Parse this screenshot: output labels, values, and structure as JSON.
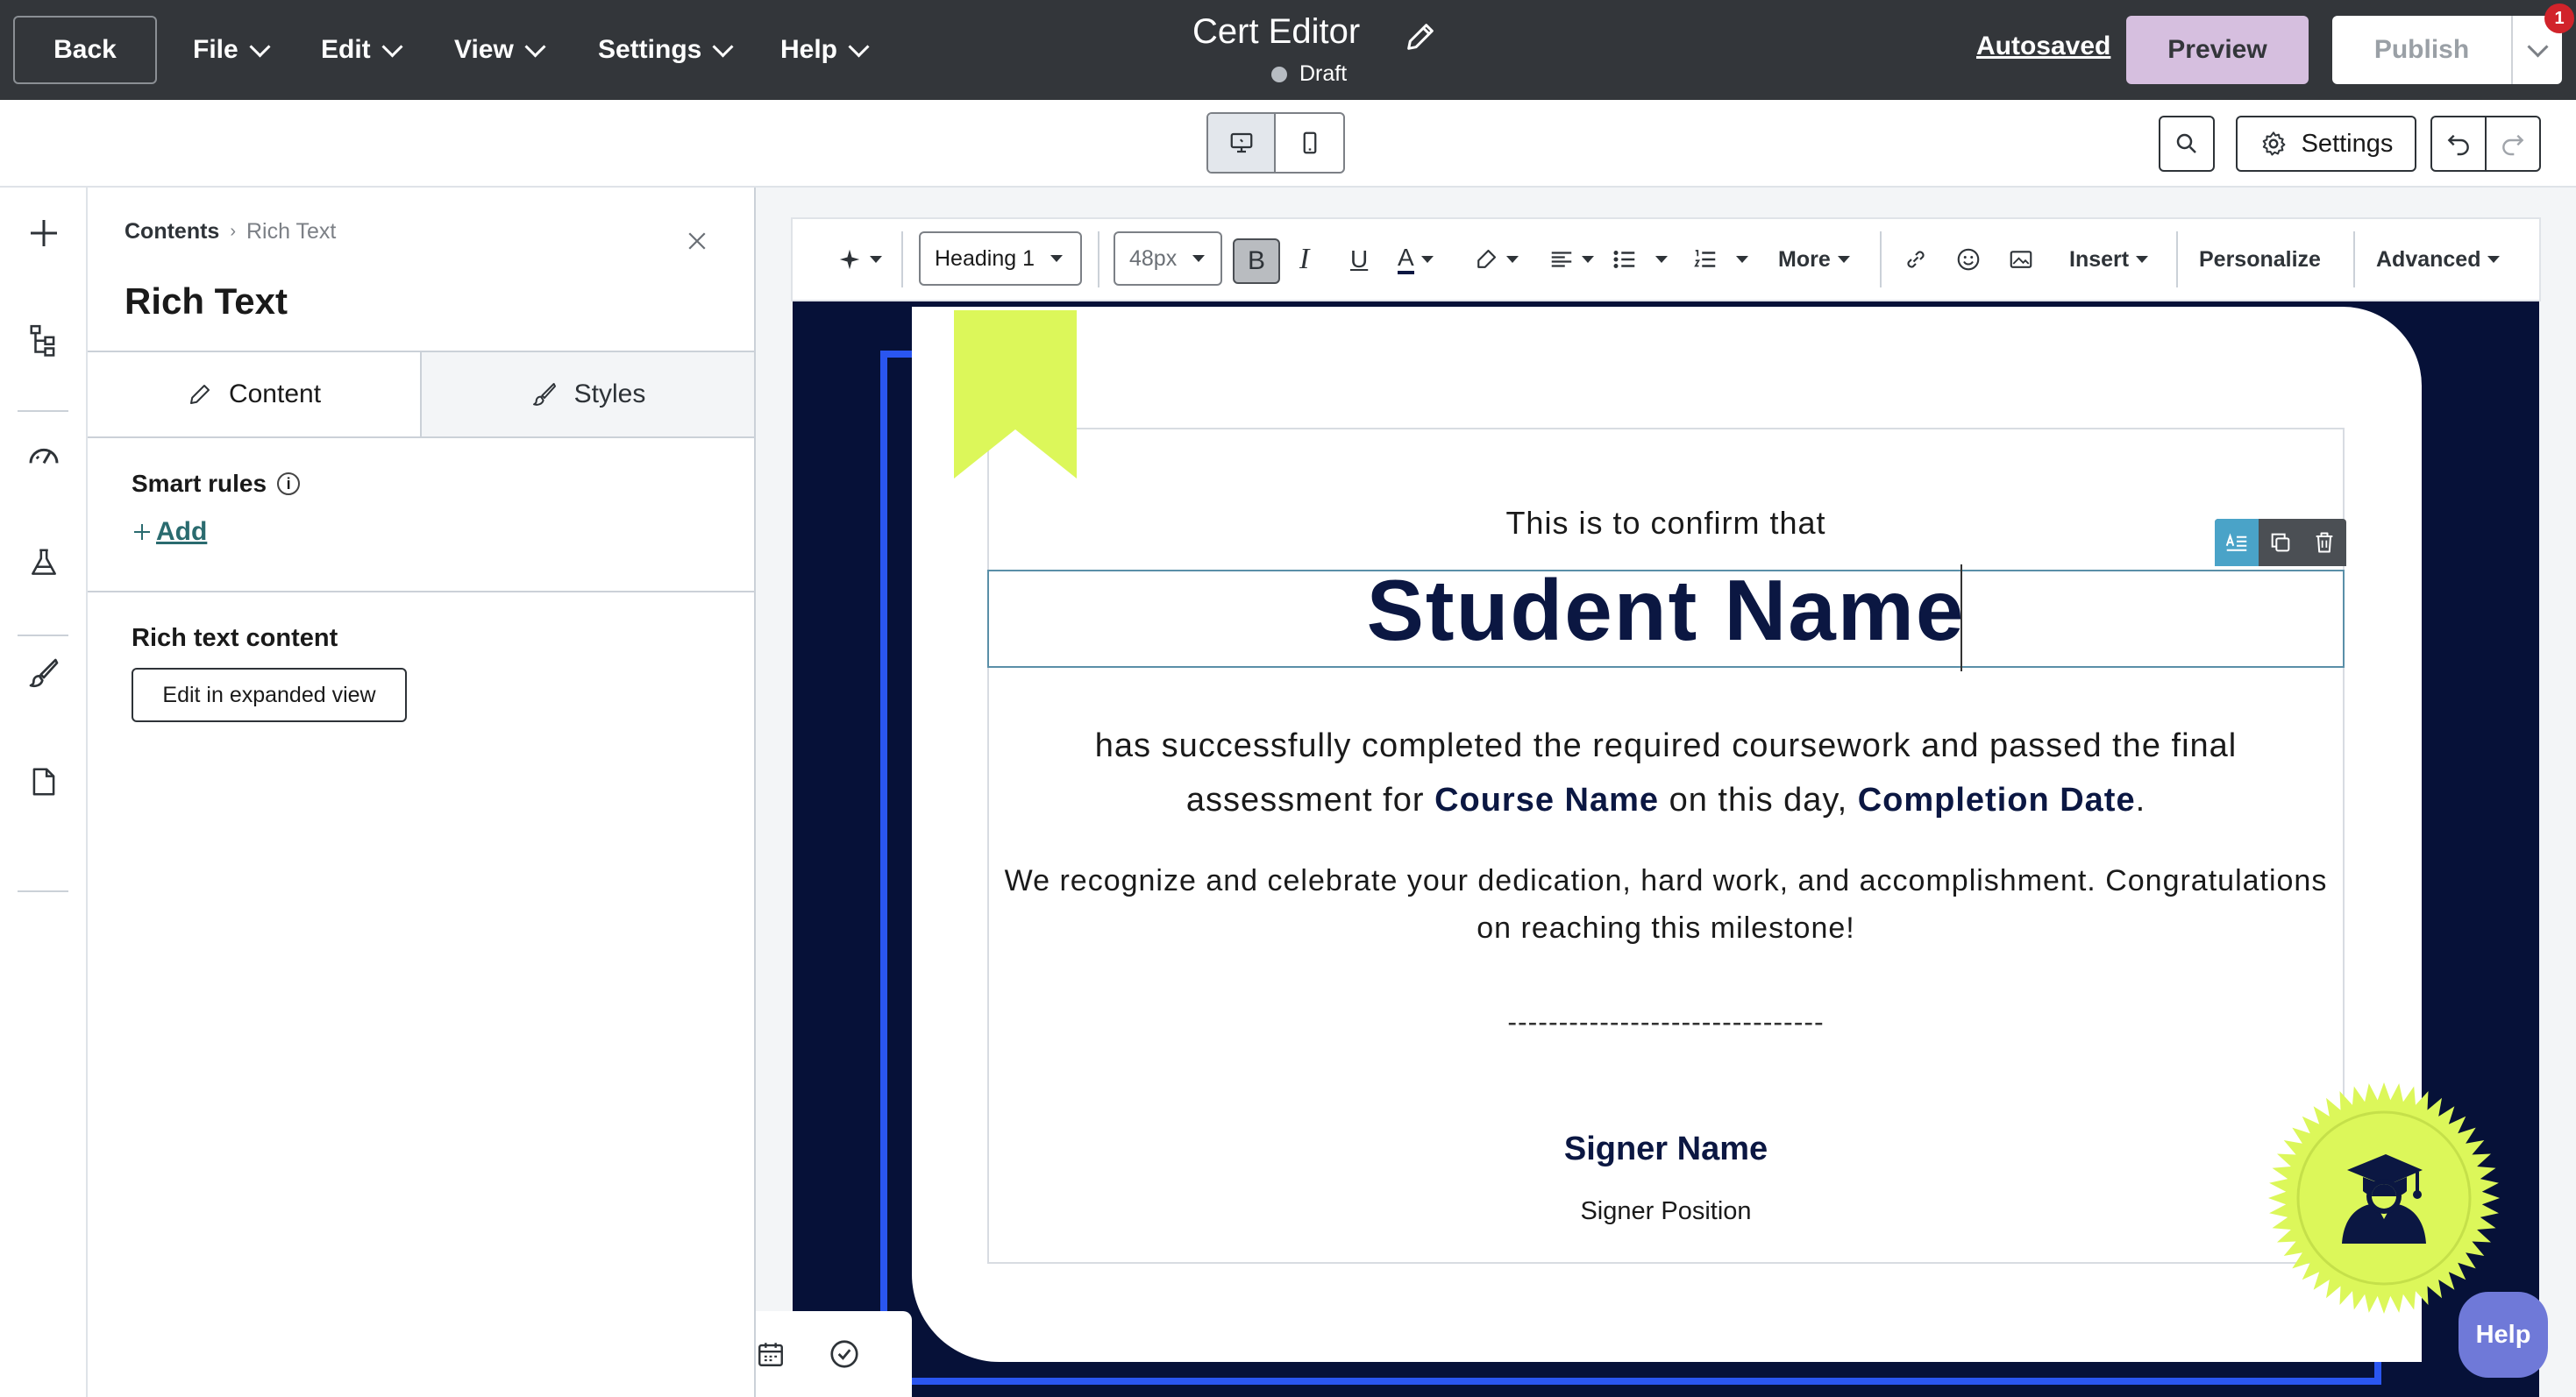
{
  "topbar": {
    "back_label": "Back",
    "menus": [
      "File",
      "Edit",
      "View",
      "Settings",
      "Help"
    ],
    "doc_title": "Cert Editor",
    "status_text": "Draft",
    "autosaved_label": "Autosaved",
    "preview_label": "Preview",
    "publish_label": "Publish",
    "notification_count": "1"
  },
  "secondbar": {
    "settings_label": "Settings"
  },
  "panel": {
    "breadcrumb_root": "Contents",
    "breadcrumb_current": "Rich Text",
    "title": "Rich Text",
    "tabs": [
      {
        "label": "Content",
        "active": true
      },
      {
        "label": "Styles",
        "active": false
      }
    ],
    "smart_rules_label": "Smart rules",
    "add_label": "Add",
    "rich_text_content_label": "Rich text content",
    "edit_expanded_label": "Edit in expanded view"
  },
  "toolbar": {
    "text_style": "Heading 1",
    "font_size": "48px",
    "more_label": "More",
    "insert_label": "Insert",
    "personalize_label": "Personalize",
    "advanced_label": "Advanced"
  },
  "certificate": {
    "confirm_text": "This is to confirm that",
    "student_name": "Student Name",
    "completion_prefix": "has successfully completed the required coursework and passed the final assessment for ",
    "course_name": "Course Name",
    "completion_middle": " on this day, ",
    "completion_date": "Completion Date",
    "completion_suffix": ".",
    "recognize_text": "We recognize and celebrate your dedication, hard work, and accomplishment. Congratulations on reaching this milestone!",
    "signature_line": "-------------------------------",
    "signer_name": "Signer Name",
    "signer_position": "Signer Position"
  },
  "help_label": "Help",
  "colors": {
    "topbar": "#33363a",
    "preview_bg": "#d6bfdf",
    "cert_navy": "#061138",
    "cert_blue": "#2a56f0",
    "accent_lime": "#dcf75a",
    "help_bg": "#6f79d8",
    "badge_red": "#d1232a"
  }
}
